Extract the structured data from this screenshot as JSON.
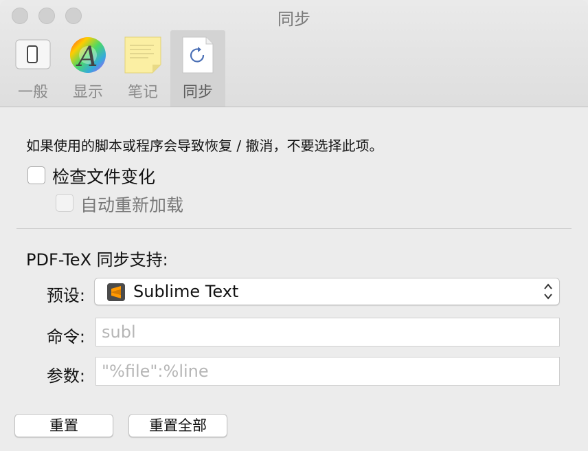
{
  "window": {
    "title": "同步"
  },
  "toolbar": {
    "items": [
      {
        "label": "一般",
        "icon": "general-switch-icon",
        "selected": false
      },
      {
        "label": "显示",
        "icon": "display-color-wheel-icon",
        "selected": false
      },
      {
        "label": "笔记",
        "icon": "notes-sticky-note-icon",
        "selected": false
      },
      {
        "label": "同步",
        "icon": "sync-document-icon",
        "selected": true
      }
    ]
  },
  "content": {
    "note": "如果使用的脚本或程序会导致恢复 / 撤消，不要选择此项。",
    "check_file_changes": {
      "label": "检查文件变化",
      "checked": false
    },
    "auto_reload": {
      "label": "自动重新加载",
      "checked": false,
      "enabled": false
    },
    "pdf_sync_section": "PDF-TeX 同步支持:",
    "preset": {
      "label": "预设:",
      "value": "Sublime Text",
      "icon": "sublime-text-icon",
      "icon_color": "#ff9800"
    },
    "command": {
      "label": "命令:",
      "value": "",
      "placeholder": "subl"
    },
    "args": {
      "label": "参数:",
      "value": "",
      "placeholder": "\"%file\":%line"
    }
  },
  "buttons": {
    "reset": "重置",
    "reset_all": "重置全部"
  }
}
